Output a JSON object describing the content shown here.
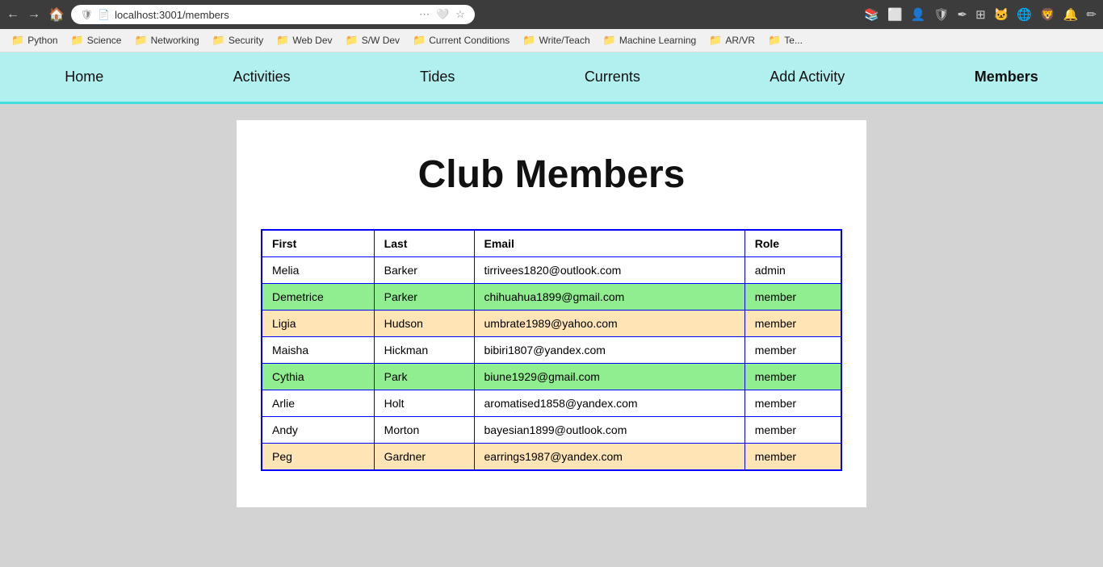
{
  "browser": {
    "url": "localhost:3001/members",
    "shield_icon": "🛡",
    "page_icon": "📄"
  },
  "bookmarks": [
    {
      "label": "Python",
      "icon": "📁"
    },
    {
      "label": "Science",
      "icon": "📁"
    },
    {
      "label": "Networking",
      "icon": "📁"
    },
    {
      "label": "Security",
      "icon": "📁"
    },
    {
      "label": "Web Dev",
      "icon": "📁"
    },
    {
      "label": "S/W Dev",
      "icon": "📁"
    },
    {
      "label": "Current Conditions",
      "icon": "📁"
    },
    {
      "label": "Write/Teach",
      "icon": "📁"
    },
    {
      "label": "Machine Learning",
      "icon": "📁"
    },
    {
      "label": "AR/VR",
      "icon": "📁"
    },
    {
      "label": "Te...",
      "icon": "📁"
    }
  ],
  "nav": {
    "items": [
      {
        "label": "Home",
        "href": "#"
      },
      {
        "label": "Activities",
        "href": "#"
      },
      {
        "label": "Tides",
        "href": "#"
      },
      {
        "label": "Currents",
        "href": "#"
      },
      {
        "label": "Add Activity",
        "href": "#"
      },
      {
        "label": "Members",
        "href": "#",
        "active": true
      }
    ]
  },
  "page": {
    "title": "Club Members"
  },
  "table": {
    "headers": [
      "First",
      "Last",
      "Email",
      "Role"
    ],
    "rows": [
      {
        "first": "Melia",
        "last": "Barker",
        "email": "tirrivees1820@outlook.com",
        "role": "admin",
        "row_class": "row-white"
      },
      {
        "first": "Demetrice",
        "last": "Parker",
        "email": "chihuahua1899@gmail.com",
        "role": "member",
        "row_class": "row-green"
      },
      {
        "first": "Ligia",
        "last": "Hudson",
        "email": "umbrate1989@yahoo.com",
        "role": "member",
        "row_class": "row-peach"
      },
      {
        "first": "Maisha",
        "last": "Hickman",
        "email": "bibiri1807@yandex.com",
        "role": "member",
        "row_class": "row-white"
      },
      {
        "first": "Cythia",
        "last": "Park",
        "email": "biune1929@gmail.com",
        "role": "member",
        "row_class": "row-green"
      },
      {
        "first": "Arlie",
        "last": "Holt",
        "email": "aromatised1858@yandex.com",
        "role": "member",
        "row_class": "row-white"
      },
      {
        "first": "Andy",
        "last": "Morton",
        "email": "bayesian1899@outlook.com",
        "role": "member",
        "row_class": "row-white"
      },
      {
        "first": "Peg",
        "last": "Gardner",
        "email": "earrings1987@yandex.com",
        "role": "member",
        "row_class": "row-peach"
      }
    ]
  }
}
